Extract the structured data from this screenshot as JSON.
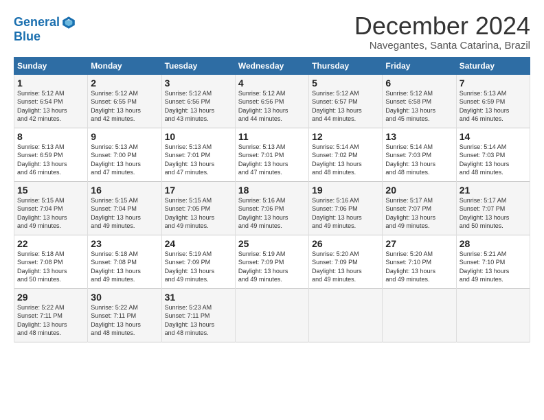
{
  "logo": {
    "line1": "General",
    "line2": "Blue"
  },
  "title": "December 2024",
  "subtitle": "Navegantes, Santa Catarina, Brazil",
  "days_header": [
    "Sunday",
    "Monday",
    "Tuesday",
    "Wednesday",
    "Thursday",
    "Friday",
    "Saturday"
  ],
  "weeks": [
    [
      {
        "day": "1",
        "sunrise": "5:12 AM",
        "sunset": "6:54 PM",
        "daylight": "13 hours and 42 minutes."
      },
      {
        "day": "2",
        "sunrise": "5:12 AM",
        "sunset": "6:55 PM",
        "daylight": "13 hours and 42 minutes."
      },
      {
        "day": "3",
        "sunrise": "5:12 AM",
        "sunset": "6:56 PM",
        "daylight": "13 hours and 43 minutes."
      },
      {
        "day": "4",
        "sunrise": "5:12 AM",
        "sunset": "6:56 PM",
        "daylight": "13 hours and 44 minutes."
      },
      {
        "day": "5",
        "sunrise": "5:12 AM",
        "sunset": "6:57 PM",
        "daylight": "13 hours and 44 minutes."
      },
      {
        "day": "6",
        "sunrise": "5:12 AM",
        "sunset": "6:58 PM",
        "daylight": "13 hours and 45 minutes."
      },
      {
        "day": "7",
        "sunrise": "5:13 AM",
        "sunset": "6:59 PM",
        "daylight": "13 hours and 46 minutes."
      }
    ],
    [
      {
        "day": "8",
        "sunrise": "5:13 AM",
        "sunset": "6:59 PM",
        "daylight": "13 hours and 46 minutes."
      },
      {
        "day": "9",
        "sunrise": "5:13 AM",
        "sunset": "7:00 PM",
        "daylight": "13 hours and 47 minutes."
      },
      {
        "day": "10",
        "sunrise": "5:13 AM",
        "sunset": "7:01 PM",
        "daylight": "13 hours and 47 minutes."
      },
      {
        "day": "11",
        "sunrise": "5:13 AM",
        "sunset": "7:01 PM",
        "daylight": "13 hours and 47 minutes."
      },
      {
        "day": "12",
        "sunrise": "5:14 AM",
        "sunset": "7:02 PM",
        "daylight": "13 hours and 48 minutes."
      },
      {
        "day": "13",
        "sunrise": "5:14 AM",
        "sunset": "7:03 PM",
        "daylight": "13 hours and 48 minutes."
      },
      {
        "day": "14",
        "sunrise": "5:14 AM",
        "sunset": "7:03 PM",
        "daylight": "13 hours and 48 minutes."
      }
    ],
    [
      {
        "day": "15",
        "sunrise": "5:15 AM",
        "sunset": "7:04 PM",
        "daylight": "13 hours and 49 minutes."
      },
      {
        "day": "16",
        "sunrise": "5:15 AM",
        "sunset": "7:04 PM",
        "daylight": "13 hours and 49 minutes."
      },
      {
        "day": "17",
        "sunrise": "5:15 AM",
        "sunset": "7:05 PM",
        "daylight": "13 hours and 49 minutes."
      },
      {
        "day": "18",
        "sunrise": "5:16 AM",
        "sunset": "7:06 PM",
        "daylight": "13 hours and 49 minutes."
      },
      {
        "day": "19",
        "sunrise": "5:16 AM",
        "sunset": "7:06 PM",
        "daylight": "13 hours and 49 minutes."
      },
      {
        "day": "20",
        "sunrise": "5:17 AM",
        "sunset": "7:07 PM",
        "daylight": "13 hours and 49 minutes."
      },
      {
        "day": "21",
        "sunrise": "5:17 AM",
        "sunset": "7:07 PM",
        "daylight": "13 hours and 50 minutes."
      }
    ],
    [
      {
        "day": "22",
        "sunrise": "5:18 AM",
        "sunset": "7:08 PM",
        "daylight": "13 hours and 50 minutes."
      },
      {
        "day": "23",
        "sunrise": "5:18 AM",
        "sunset": "7:08 PM",
        "daylight": "13 hours and 49 minutes."
      },
      {
        "day": "24",
        "sunrise": "5:19 AM",
        "sunset": "7:09 PM",
        "daylight": "13 hours and 49 minutes."
      },
      {
        "day": "25",
        "sunrise": "5:19 AM",
        "sunset": "7:09 PM",
        "daylight": "13 hours and 49 minutes."
      },
      {
        "day": "26",
        "sunrise": "5:20 AM",
        "sunset": "7:09 PM",
        "daylight": "13 hours and 49 minutes."
      },
      {
        "day": "27",
        "sunrise": "5:20 AM",
        "sunset": "7:10 PM",
        "daylight": "13 hours and 49 minutes."
      },
      {
        "day": "28",
        "sunrise": "5:21 AM",
        "sunset": "7:10 PM",
        "daylight": "13 hours and 49 minutes."
      }
    ],
    [
      {
        "day": "29",
        "sunrise": "5:22 AM",
        "sunset": "7:11 PM",
        "daylight": "13 hours and 48 minutes."
      },
      {
        "day": "30",
        "sunrise": "5:22 AM",
        "sunset": "7:11 PM",
        "daylight": "13 hours and 48 minutes."
      },
      {
        "day": "31",
        "sunrise": "5:23 AM",
        "sunset": "7:11 PM",
        "daylight": "13 hours and 48 minutes."
      },
      null,
      null,
      null,
      null
    ]
  ]
}
